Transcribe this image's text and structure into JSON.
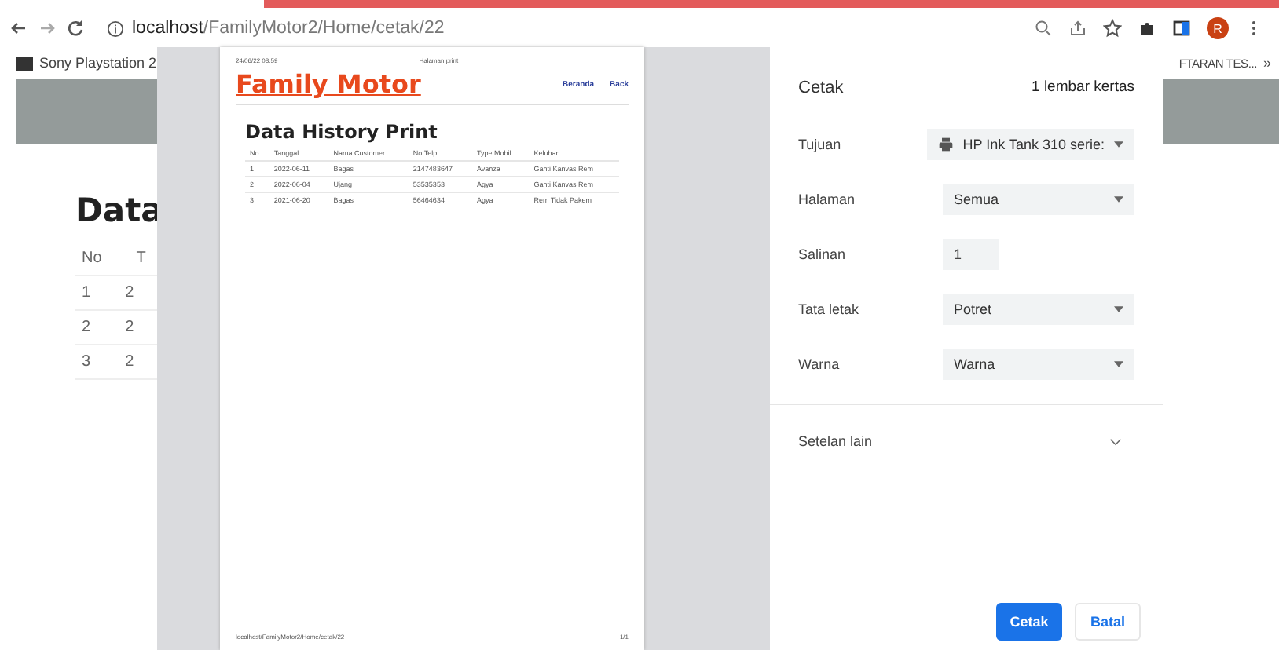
{
  "browser": {
    "url_host": "localhost",
    "url_path": "/FamilyMotor2/Home/cetak/22",
    "avatar": "R",
    "bookmarks": [
      "Sony Playstation 2",
      "FTARAN TES..."
    ],
    "more": "»"
  },
  "background_page": {
    "heading": "Data",
    "columns": [
      "No",
      "T"
    ],
    "rows": [
      [
        "1",
        "2"
      ],
      [
        "2",
        "2"
      ],
      [
        "3",
        "2"
      ]
    ]
  },
  "preview": {
    "date": "24/06/22 08.59",
    "page_title": "Halaman print",
    "brand": "Family Motor",
    "nav": [
      "Beranda",
      "Back"
    ],
    "heading": "Data History Print",
    "columns": [
      "No",
      "Tanggal",
      "Nama Customer",
      "No.Telp",
      "Type Mobil",
      "Keluhan"
    ],
    "rows": [
      [
        "1",
        "2022-06-11",
        "Bagas",
        "2147483647",
        "Avanza",
        "Ganti Kanvas Rem"
      ],
      [
        "2",
        "2022-06-04",
        "Ujang",
        "53535353",
        "Agya",
        "Ganti Kanvas Rem"
      ],
      [
        "3",
        "2021-06-20",
        "Bagas",
        "56464634",
        "Agya",
        "Rem Tidak Pakem"
      ]
    ],
    "footer_url": "localhost/FamilyMotor2/Home/cetak/22",
    "footer_page": "1/1"
  },
  "print_panel": {
    "title": "Cetak",
    "sheets": "1 lembar kertas",
    "settings": [
      {
        "label": "Tujuan",
        "kind": "printer",
        "value": "HP Ink Tank 310 serie:"
      },
      {
        "label": "Halaman",
        "kind": "select",
        "value": "Semua"
      },
      {
        "label": "Salinan",
        "kind": "number",
        "value": "1"
      },
      {
        "label": "Tata letak",
        "kind": "select",
        "value": "Potret"
      },
      {
        "label": "Warna",
        "kind": "select",
        "value": "Warna"
      }
    ],
    "more_settings": "Setelan lain",
    "buttons": [
      {
        "label": "Cetak",
        "kind": "primary"
      },
      {
        "label": "Batal",
        "kind": "secondary"
      }
    ]
  }
}
